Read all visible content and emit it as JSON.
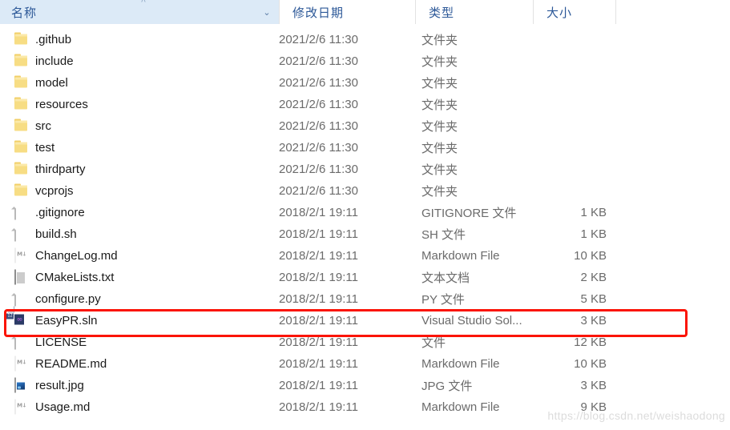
{
  "header": {
    "columns": [
      {
        "label": "名称",
        "key": "name"
      },
      {
        "label": "修改日期",
        "key": "date"
      },
      {
        "label": "类型",
        "key": "type"
      },
      {
        "label": "大小",
        "key": "size"
      }
    ],
    "sort_indicator": "˄",
    "dropdown_chevron": "⌄",
    "active_column": "名称",
    "active_column_bg": "#dceaf7",
    "header_text_color": "#2b5797"
  },
  "rows": [
    {
      "icon": "folder-icon",
      "name": ".github",
      "date": "2021/2/6 11:30",
      "type": "文件夹",
      "size": ""
    },
    {
      "icon": "folder-icon",
      "name": "include",
      "date": "2021/2/6 11:30",
      "type": "文件夹",
      "size": ""
    },
    {
      "icon": "folder-icon",
      "name": "model",
      "date": "2021/2/6 11:30",
      "type": "文件夹",
      "size": ""
    },
    {
      "icon": "folder-icon",
      "name": "resources",
      "date": "2021/2/6 11:30",
      "type": "文件夹",
      "size": ""
    },
    {
      "icon": "folder-icon",
      "name": "src",
      "date": "2021/2/6 11:30",
      "type": "文件夹",
      "size": ""
    },
    {
      "icon": "folder-icon",
      "name": "test",
      "date": "2021/2/6 11:30",
      "type": "文件夹",
      "size": ""
    },
    {
      "icon": "folder-icon",
      "name": "thirdparty",
      "date": "2021/2/6 11:30",
      "type": "文件夹",
      "size": ""
    },
    {
      "icon": "folder-icon",
      "name": "vcprojs",
      "date": "2021/2/6 11:30",
      "type": "文件夹",
      "size": ""
    },
    {
      "icon": "blank-document-icon",
      "name": ".gitignore",
      "date": "2018/2/1 19:11",
      "type": "GITIGNORE 文件",
      "size": "1 KB"
    },
    {
      "icon": "blank-document-icon",
      "name": "build.sh",
      "date": "2018/2/1 19:11",
      "type": "SH 文件",
      "size": "1 KB"
    },
    {
      "icon": "markdown-icon",
      "name": "ChangeLog.md",
      "date": "2018/2/1 19:11",
      "type": "Markdown File",
      "size": "10 KB"
    },
    {
      "icon": "text-document-icon",
      "name": "CMakeLists.txt",
      "date": "2018/2/1 19:11",
      "type": "文本文档",
      "size": "2 KB"
    },
    {
      "icon": "blank-document-icon",
      "name": "configure.py",
      "date": "2018/2/1 19:11",
      "type": "PY 文件",
      "size": "5 KB"
    },
    {
      "icon": "visual-studio-solution-icon",
      "name": "EasyPR.sln",
      "date": "2018/2/1 19:11",
      "type": "Visual Studio Sol...",
      "size": "3 KB",
      "highlighted": true
    },
    {
      "icon": "blank-document-icon",
      "name": "LICENSE",
      "date": "2018/2/1 19:11",
      "type": "文件",
      "size": "12 KB"
    },
    {
      "icon": "markdown-icon",
      "name": "README.md",
      "date": "2018/2/1 19:11",
      "type": "Markdown File",
      "size": "10 KB"
    },
    {
      "icon": "image-icon",
      "name": "result.jpg",
      "date": "2018/2/1 19:11",
      "type": "JPG 文件",
      "size": "3 KB"
    },
    {
      "icon": "markdown-icon",
      "name": "Usage.md",
      "date": "2018/2/1 19:11",
      "type": "Markdown File",
      "size": "9 KB"
    }
  ],
  "highlight": {
    "target_row": "EasyPR.sln",
    "color": "#fb1405"
  },
  "watermark": {
    "text": "https://blog.csdn.net/weishaodong",
    "color": "#dcdcdc"
  },
  "icon_glyphs": {
    "markdown": "M↓",
    "vs_badge": "12",
    "vs_symbol": "∞"
  }
}
